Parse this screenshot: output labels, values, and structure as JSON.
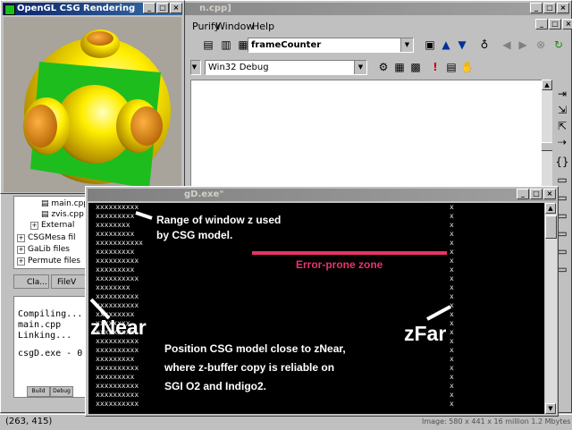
{
  "ide": {
    "title_fragment": "n.cpp]",
    "menu": [
      "Purify",
      "Window",
      "Help"
    ],
    "member_combo": "frameCounter",
    "config_combo": "Win32 Debug",
    "tree": [
      "main.cpp",
      "zvis.cpp",
      "External",
      "CSGMesa fil",
      "GaLib files",
      "Permute files"
    ],
    "tabs": [
      "Cla...",
      "FileV"
    ],
    "output_lines": [
      "Compiling...",
      "main.cpp",
      "Linking...",
      "",
      "csgD.exe - 0"
    ],
    "output_tabs": [
      "Build",
      "Debug"
    ],
    "status_left": "(263, 415)",
    "status_right": "Image: 580 x 441 x 16 million    1.2 Mbytes"
  },
  "csg_window": {
    "title": "OpenGL CSG Rendering"
  },
  "console": {
    "title": "gD.exe\"",
    "left_column": [
      "xxxxxxxxxx",
      "xxxxxxxxx",
      "xxxxxxxx",
      "xxxxxxxxx",
      "xxxxxxxxxxx",
      "xxxxxxxxx",
      "xxxxxxxxxx",
      "xxxxxxxxx",
      "xxxxxxxxxx",
      "xxxxxxxx",
      "xxxxxxxxxx",
      "xxxxxxxxxx",
      "xxxxxxxxx",
      "xxxxxxxx",
      "xxxxxxxxx",
      "xxxxxxxxxx",
      "xxxxxxxxxx",
      "xxxxxxxxx",
      "xxxxxxxxxx",
      "xxxxxxxxx",
      "xxxxxxxxxx",
      "xxxxxxxxxx",
      "xxxxxxxxxx"
    ],
    "right_column_count": 23,
    "right_glyph": "x"
  },
  "annotations": {
    "range": "Range of window z used\nby CSG model.",
    "error_zone": "Error-prone zone",
    "znear": "zNear",
    "zfar": "zFar",
    "position": "Position CSG model close to zNear,\nwhere z-buffer copy is reliable on\nSGI O2 and Indigo2."
  },
  "colors": {
    "console_bg": "#000000",
    "error_zone": "#e8336a",
    "title_active": "#0a246a",
    "desktop_bg": "#c0c0c0",
    "csg_viewport": "#a8a39b",
    "cube": "#1ebd1e",
    "yellow": "#ffee00",
    "orange": "#e08a10"
  }
}
